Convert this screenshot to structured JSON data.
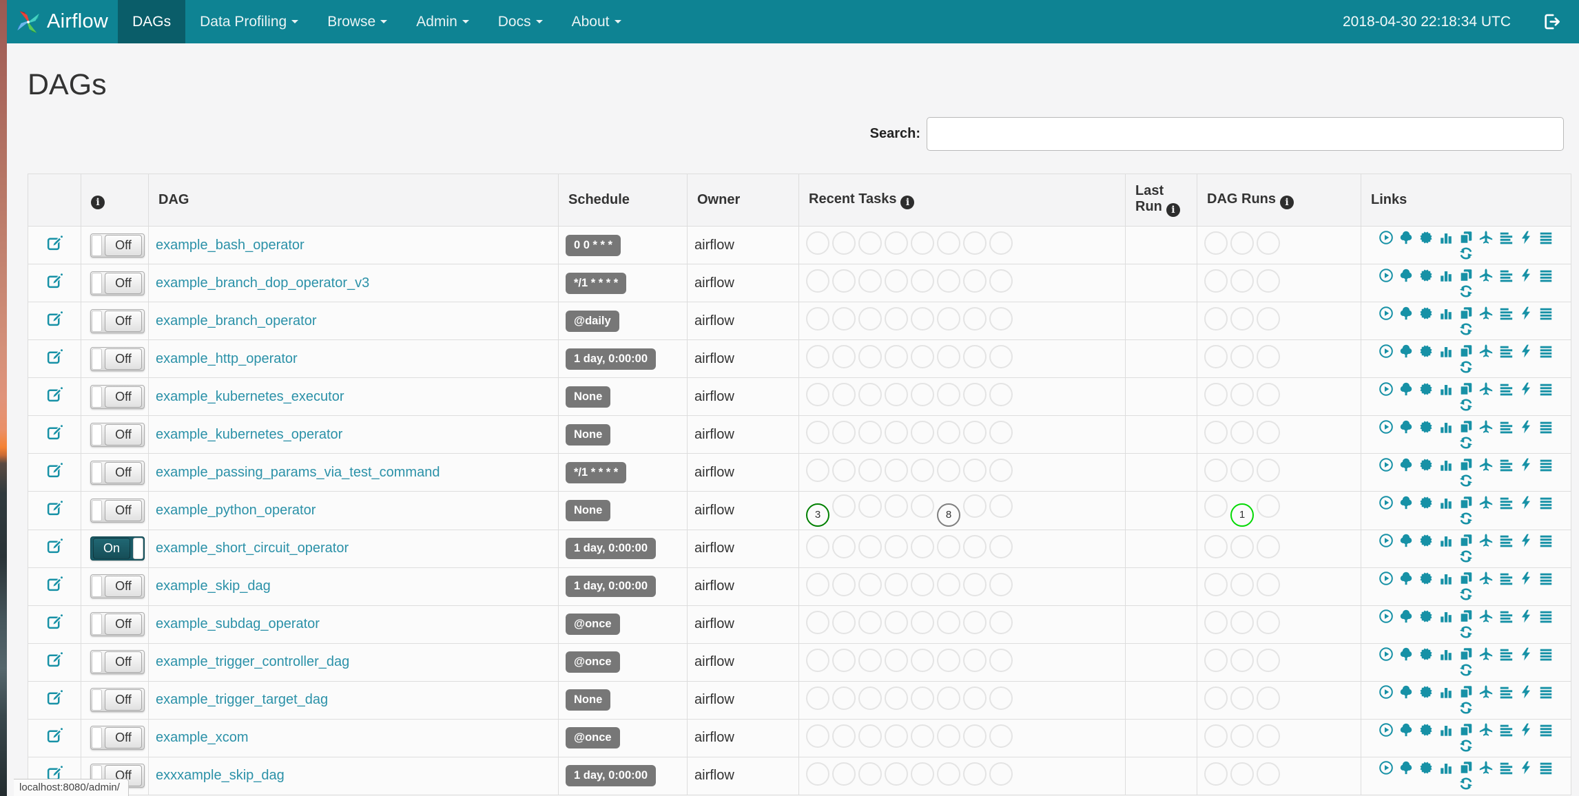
{
  "colors": {
    "navbar_bg": "#0e8393",
    "navbar_active_bg": "#0a5d69",
    "link": "#2b91a8",
    "icon": "#1791a6",
    "badge_bg": "#777777",
    "toggle_on_bg": "#1b5a66",
    "task_success": "#008000",
    "task_queued": "#7f7f7f",
    "dagrun_running": "#04d904"
  },
  "navbar": {
    "brand": "Airflow",
    "items": [
      {
        "label": "DAGs",
        "active": true,
        "caret": false
      },
      {
        "label": "Data Profiling",
        "active": false,
        "caret": true
      },
      {
        "label": "Browse",
        "active": false,
        "caret": true
      },
      {
        "label": "Admin",
        "active": false,
        "caret": true
      },
      {
        "label": "Docs",
        "active": false,
        "caret": true
      },
      {
        "label": "About",
        "active": false,
        "caret": true
      }
    ],
    "clock": "2018-04-30 22:18:34 UTC"
  },
  "page": {
    "title": "DAGs",
    "status_bar": "localhost:8080/admin/"
  },
  "search": {
    "label": "Search:",
    "value": "",
    "placeholder": ""
  },
  "table": {
    "headers": {
      "dag": "DAG",
      "schedule": "Schedule",
      "owner": "Owner",
      "recent_tasks": "Recent Tasks",
      "last_run": "Last Run",
      "dag_runs": "DAG Runs",
      "links": "Links"
    },
    "recent_task_slots": 8,
    "dag_run_slots": 3
  },
  "links": [
    {
      "name": "trigger-dag",
      "title": "Trigger Dag",
      "icon": "play-circle-icon",
      "sym": "play-circle"
    },
    {
      "name": "tree-view",
      "title": "Tree View",
      "icon": "tree-icon",
      "sym": "tree"
    },
    {
      "name": "graph-view",
      "title": "Graph View",
      "icon": "burst-icon",
      "sym": "burst"
    },
    {
      "name": "task-duration",
      "title": "Task Duration",
      "icon": "bar-chart-icon",
      "sym": "bars"
    },
    {
      "name": "task-tries",
      "title": "Task Tries",
      "icon": "copy-icon",
      "sym": "copy"
    },
    {
      "name": "landing-times",
      "title": "Landing Times",
      "icon": "plane-icon",
      "sym": "plane"
    },
    {
      "name": "gantt-view",
      "title": "Gantt View",
      "icon": "align-left-icon",
      "sym": "align-left"
    },
    {
      "name": "code-view",
      "title": "Code View",
      "icon": "bolt-icon",
      "sym": "bolt"
    },
    {
      "name": "logs",
      "title": "Logs",
      "icon": "align-justify-icon",
      "sym": "align-justify"
    },
    {
      "name": "refresh-dag",
      "title": "Refresh DAG",
      "icon": "refresh-icon",
      "sym": "refresh"
    }
  ],
  "dags": [
    {
      "name": "example_bash_operator",
      "enabled": false,
      "toggle_label": "Off",
      "schedule": "0 0 * * *",
      "owner": "airflow",
      "recent_tasks": [],
      "dag_runs": []
    },
    {
      "name": "example_branch_dop_operator_v3",
      "enabled": false,
      "toggle_label": "Off",
      "schedule": "*/1 * * * *",
      "owner": "airflow",
      "recent_tasks": [],
      "dag_runs": []
    },
    {
      "name": "example_branch_operator",
      "enabled": false,
      "toggle_label": "Off",
      "schedule": "@daily",
      "owner": "airflow",
      "recent_tasks": [],
      "dag_runs": []
    },
    {
      "name": "example_http_operator",
      "enabled": false,
      "toggle_label": "Off",
      "schedule": "1 day, 0:00:00",
      "owner": "airflow",
      "recent_tasks": [],
      "dag_runs": []
    },
    {
      "name": "example_kubernetes_executor",
      "enabled": false,
      "toggle_label": "Off",
      "schedule": "None",
      "owner": "airflow",
      "recent_tasks": [],
      "dag_runs": []
    },
    {
      "name": "example_kubernetes_operator",
      "enabled": false,
      "toggle_label": "Off",
      "schedule": "None",
      "owner": "airflow",
      "recent_tasks": [],
      "dag_runs": []
    },
    {
      "name": "example_passing_params_via_test_command",
      "enabled": false,
      "toggle_label": "Off",
      "schedule": "*/1 * * * *",
      "owner": "airflow",
      "recent_tasks": [],
      "dag_runs": []
    },
    {
      "name": "example_python_operator",
      "enabled": false,
      "toggle_label": "Off",
      "schedule": "None",
      "owner": "airflow",
      "recent_tasks": [
        {
          "count": 3,
          "state": "success",
          "color": "#008000"
        },
        null,
        null,
        null,
        null,
        {
          "count": 8,
          "state": "queued",
          "color": "#7f7f7f"
        },
        null,
        null
      ],
      "dag_runs": [
        null,
        {
          "count": 1,
          "state": "running",
          "color": "#04d904"
        },
        null
      ]
    },
    {
      "name": "example_short_circuit_operator",
      "enabled": true,
      "toggle_label": "On",
      "schedule": "1 day, 0:00:00",
      "owner": "airflow",
      "recent_tasks": [],
      "dag_runs": []
    },
    {
      "name": "example_skip_dag",
      "enabled": false,
      "toggle_label": "Off",
      "schedule": "1 day, 0:00:00",
      "owner": "airflow",
      "recent_tasks": [],
      "dag_runs": []
    },
    {
      "name": "example_subdag_operator",
      "enabled": false,
      "toggle_label": "Off",
      "schedule": "@once",
      "owner": "airflow",
      "recent_tasks": [],
      "dag_runs": []
    },
    {
      "name": "example_trigger_controller_dag",
      "enabled": false,
      "toggle_label": "Off",
      "schedule": "@once",
      "owner": "airflow",
      "recent_tasks": [],
      "dag_runs": []
    },
    {
      "name": "example_trigger_target_dag",
      "enabled": false,
      "toggle_label": "Off",
      "schedule": "None",
      "owner": "airflow",
      "recent_tasks": [],
      "dag_runs": []
    },
    {
      "name": "example_xcom",
      "enabled": false,
      "toggle_label": "Off",
      "schedule": "@once",
      "owner": "airflow",
      "recent_tasks": [],
      "dag_runs": []
    },
    {
      "name": "exxxample_skip_dag",
      "enabled": false,
      "toggle_label": "Off",
      "schedule": "1 day, 0:00:00",
      "owner": "airflow",
      "recent_tasks": [],
      "dag_runs": []
    }
  ]
}
